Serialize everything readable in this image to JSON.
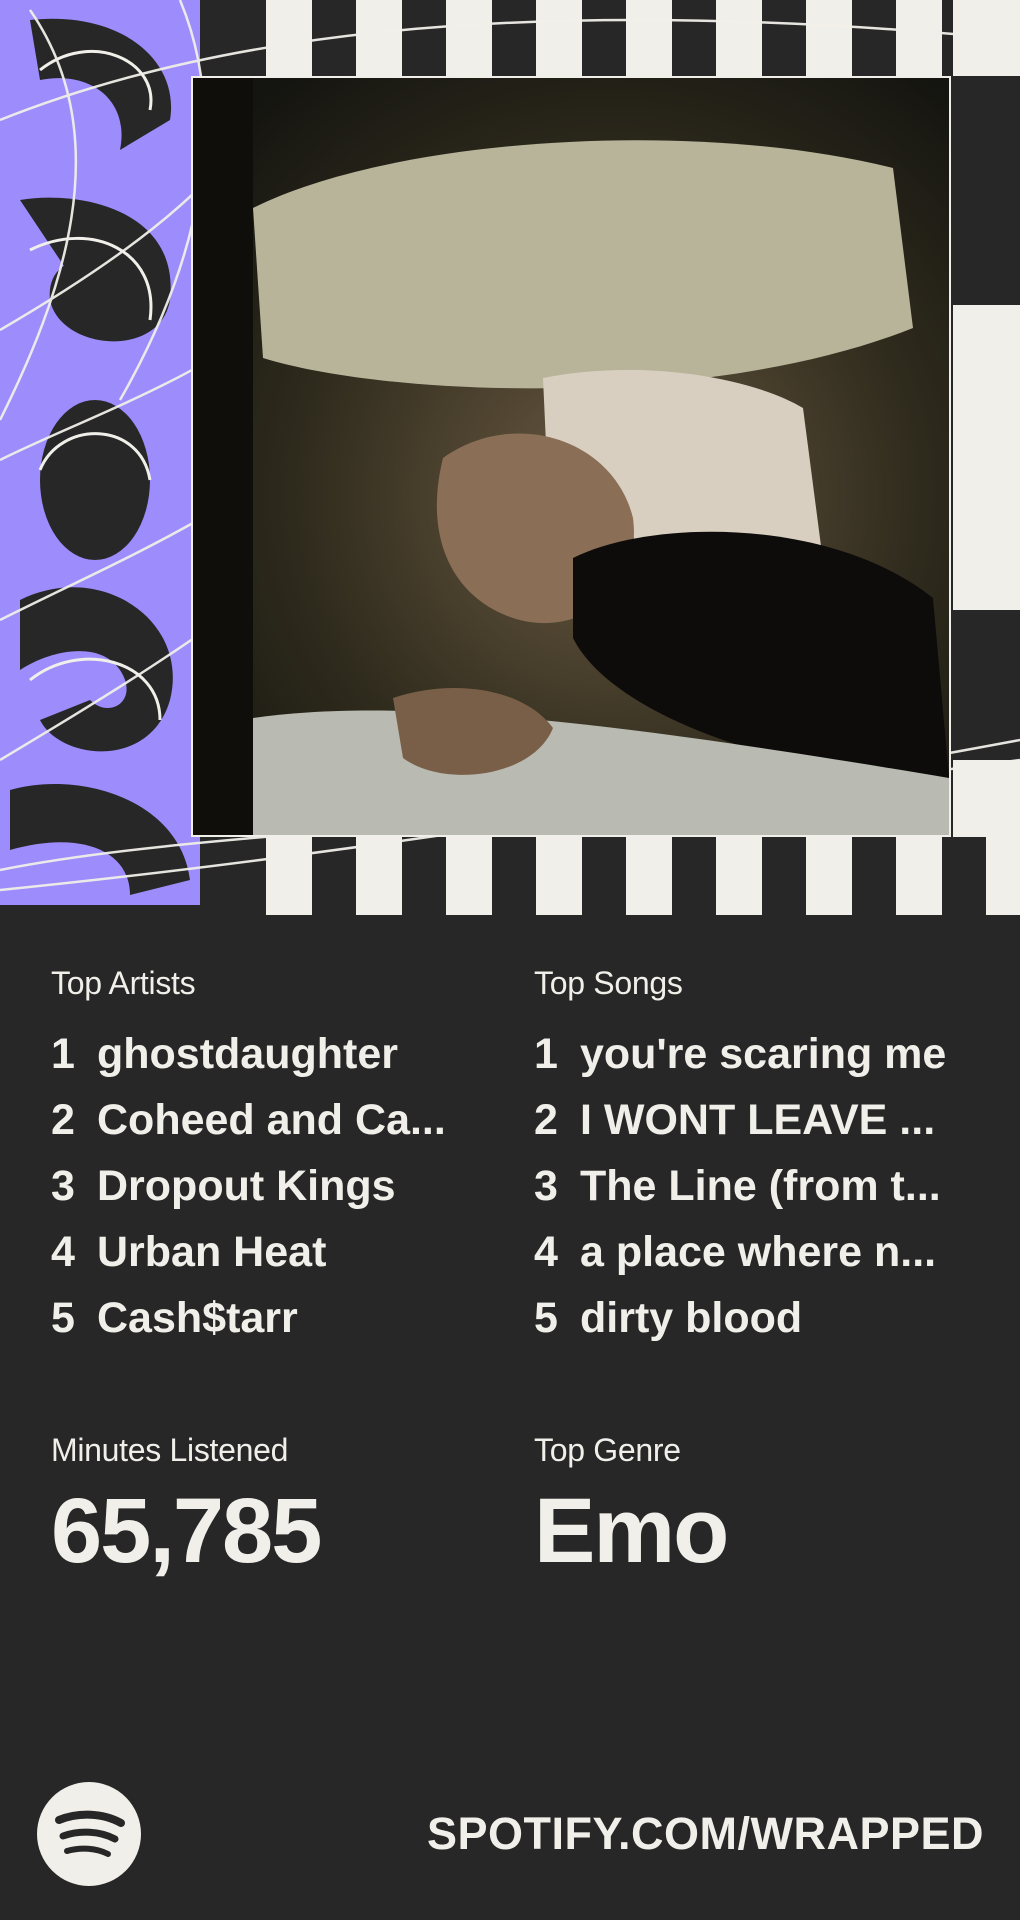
{
  "hero": {
    "year_graphic": "2025",
    "photo_alt": "Top artist image"
  },
  "top_artists": {
    "label": "Top Artists",
    "items": [
      {
        "rank": "1",
        "name": "ghostdaughter"
      },
      {
        "rank": "2",
        "name": "Coheed and Ca..."
      },
      {
        "rank": "3",
        "name": "Dropout Kings"
      },
      {
        "rank": "4",
        "name": "Urban Heat"
      },
      {
        "rank": "5",
        "name": "Cash$tarr"
      }
    ]
  },
  "top_songs": {
    "label": "Top Songs",
    "items": [
      {
        "rank": "1",
        "name": "you're scaring me"
      },
      {
        "rank": "2",
        "name": "I WONT LEAVE ..."
      },
      {
        "rank": "3",
        "name": "The Line (from t..."
      },
      {
        "rank": "4",
        "name": "a place where n..."
      },
      {
        "rank": "5",
        "name": "dirty blood"
      }
    ]
  },
  "minutes": {
    "label": "Minutes Listened",
    "value": "65,785"
  },
  "genre": {
    "label": "Top Genre",
    "value": "Emo"
  },
  "footer": {
    "logo_icon": "spotify-logo-icon",
    "url": "SPOTIFY.COM/WRAPPED"
  },
  "colors": {
    "background": "#272727",
    "text": "#f1efe9",
    "accent": "#9d8cfc",
    "stripe_light": "#f1efe9"
  }
}
